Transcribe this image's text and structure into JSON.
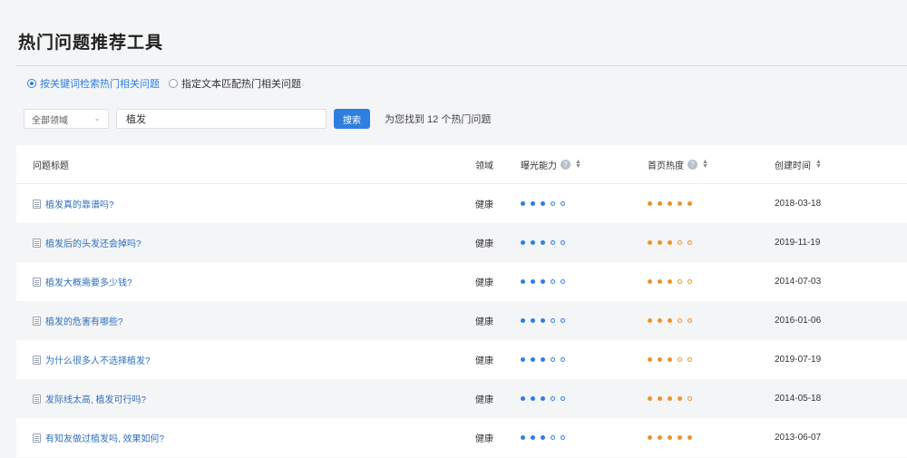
{
  "page_title": "热门问题推荐工具",
  "search_modes": [
    {
      "label": "按关键词检索热门相关问题",
      "checked": true
    },
    {
      "label": "指定文本匹配热门相关问题",
      "checked": false
    }
  ],
  "domain_select": {
    "value": "全部领域"
  },
  "keyword_input": {
    "value": "植发"
  },
  "search_button": "搜索",
  "result_text": "为您找到 12 个热门问题",
  "columns": {
    "title": "问题标题",
    "domain": "领域",
    "exposure": "曝光能力",
    "heat": "首页热度",
    "created": "创建时间"
  },
  "colors": {
    "accent": "#2f7fe0",
    "exposure_dot": "#2f7fe0",
    "heat_dot": "#f0922b"
  },
  "rows": [
    {
      "title": "植发真的靠谱吗?",
      "domain": "健康",
      "exposure": 3,
      "heat": 5,
      "created": "2018-03-18"
    },
    {
      "title": "植发后的头发还会掉吗?",
      "domain": "健康",
      "exposure": 3,
      "heat": 3,
      "created": "2019-11-19"
    },
    {
      "title": "植发大概需要多少钱?",
      "domain": "健康",
      "exposure": 3,
      "heat": 3,
      "created": "2014-07-03"
    },
    {
      "title": "植发的危害有哪些?",
      "domain": "健康",
      "exposure": 3,
      "heat": 3,
      "created": "2016-01-06"
    },
    {
      "title": "为什么很多人不选择植发?",
      "domain": "健康",
      "exposure": 3,
      "heat": 3,
      "created": "2019-07-19"
    },
    {
      "title": "发际线太高, 植发可行吗?",
      "domain": "健康",
      "exposure": 3,
      "heat": 4,
      "created": "2014-05-18"
    },
    {
      "title": "有知友做过植发吗, 效果如何?",
      "domain": "健康",
      "exposure": 3,
      "heat": 5,
      "created": "2013-06-07"
    }
  ]
}
